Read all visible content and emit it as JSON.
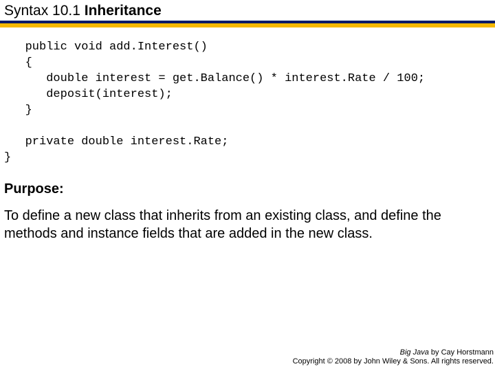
{
  "title": {
    "prefix": "Syntax 10.1 ",
    "bold": "Inheritance"
  },
  "code": "   public void add.Interest()\n   {\n      double interest = get.Balance() * interest.Rate / 100;\n      deposit(interest);\n   }\n\n   private double interest.Rate;\n}",
  "purpose": {
    "heading": "Purpose:",
    "body": "To define a new class that inherits from an existing class, and define the methods and instance fields that are added in the new class."
  },
  "footer": {
    "line1_book": "Big Java",
    "line1_rest": " by Cay Horstmann",
    "line2": "Copyright © 2008 by John Wiley & Sons.  All rights reserved."
  }
}
